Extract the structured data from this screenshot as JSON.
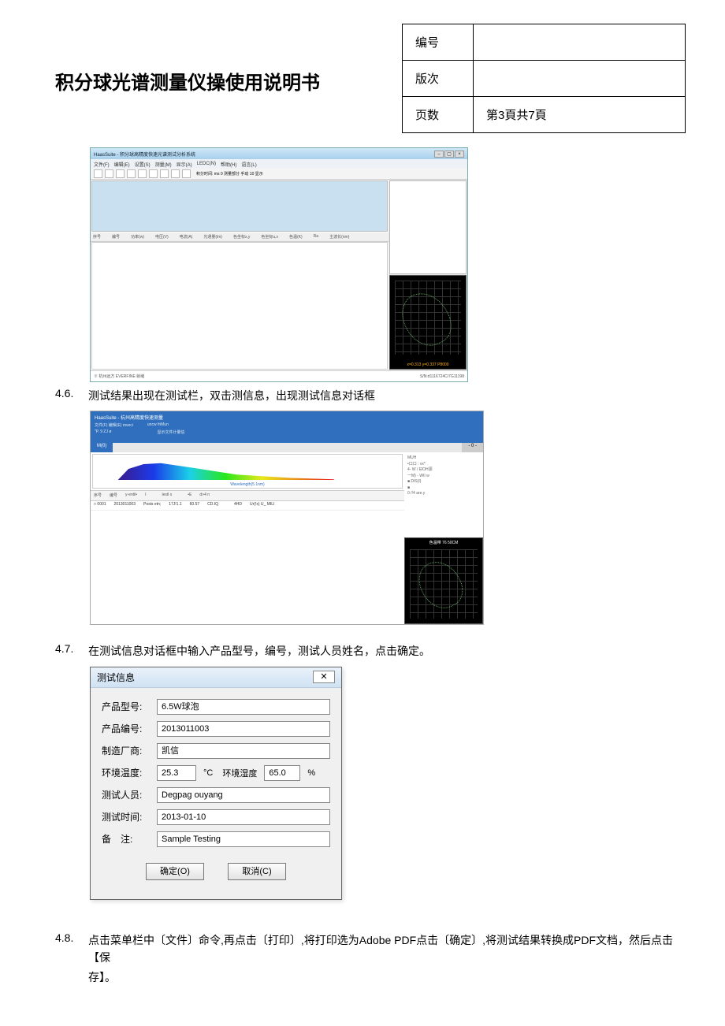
{
  "header": {
    "title": "积分球光谱测量仪操使用说明书",
    "meta": {
      "row1_label": "编号",
      "row1_value": "",
      "row2_label": "版次",
      "row2_value": "",
      "row3_label": "页数",
      "row3_value": "第3頁共7頁"
    }
  },
  "shot1": {
    "window_title": "HaasSuite - 积分球高精度快速光谱测试分析系统",
    "menu": [
      "文件(F)",
      "编辑(E)",
      "设置(S)",
      "测量(M)",
      "显示(A)",
      "LEDC(N)",
      "帮助(H)",
      "语言(L)"
    ],
    "toolbar_right": "积分时间: ms 0    测量部分 手动 10  显示",
    "grid_headers": [
      "序号",
      "编号",
      "功率(w)",
      "电压(V)",
      "电流(A)",
      "光通量(lm)",
      "色坐标x,y",
      "色坐标u,v",
      "色温(K)",
      "Ra",
      "主波长(nm)"
    ],
    "status_left": "※ 杭州远方 EVERFINE  就绪",
    "status_right": "S/N:d1116724C/7G11198",
    "cie_label": "x=0.313 y=0.337 P8000"
  },
  "step46": {
    "num": "4.6.",
    "text": "测试结果出现在测试栏，双击测信息，出现测试信息对话框"
  },
  "shot2": {
    "window_title": "HaasSuite - 杭州高精度快速测量",
    "sub1": "文件(F)  编辑(E)  mveci",
    "sub2": "uncw friMun",
    "sub3": "\"P. 9 ZJ ø",
    "sub4": "显示文件计量信",
    "tab_active": "M(0)",
    "tab_other": "- 0 -",
    "spectrum_label": "Wavelength(5.1nm)",
    "grid_headers": [
      "序号",
      "编号",
      "y-entil•",
      "I",
      "",
      "lestl x",
      "",
      "•E",
      "d>4 n"
    ],
    "row0": [
      "□ 0001",
      "2013011003",
      "Posts   etn;",
      "17J!1.1",
      "60.57",
      "CD.IQ",
      "",
      "4HD",
      "Ur(!x) U_ MILI"
    ],
    "right_info": [
      "MUH",
      "",
      "•口口 : vx*",
      "4- W / ElOH源",
      "一M) -  WII w",
      "■              DIS(I)",
      "■",
      "0 /!4 are.y"
    ],
    "cie_title": "色温带 76 50CM"
  },
  "step47": {
    "num": "4.7.",
    "text": "在测试信息对话框中输入产品型号，编号，测试人员姓名，点击确定。"
  },
  "dialog": {
    "title": "测试信息",
    "close": "✕",
    "fields": {
      "model_label": "产品型号:",
      "model_value": "6.5W球泡",
      "code_label": "产品编号:",
      "code_value": "2013011003",
      "maker_label": "制造厂商:",
      "maker_value": "凯信",
      "temp_label": "环境温度:",
      "temp_value": "25.3",
      "temp_unit": "°C",
      "humid_label": "环境湿度",
      "humid_value": "65.0",
      "humid_unit": "%",
      "tester_label": "测试人员:",
      "tester_value": "Degpag ouyang",
      "time_label": "测试时间:",
      "time_value": "2013-01-10",
      "remark_label": "备　注:",
      "remark_value": "Sample Testing"
    },
    "ok": "确定(O)",
    "cancel": "取消(C)"
  },
  "step48": {
    "num": "4.8.",
    "text": "点击菜单栏中〔文件〕命令,再点击〔打印〕,将打印选为Adobe PDF点击〔确定〕,将测试结果转换成PDF文档，然后点击【保",
    "text2": "存】。"
  }
}
